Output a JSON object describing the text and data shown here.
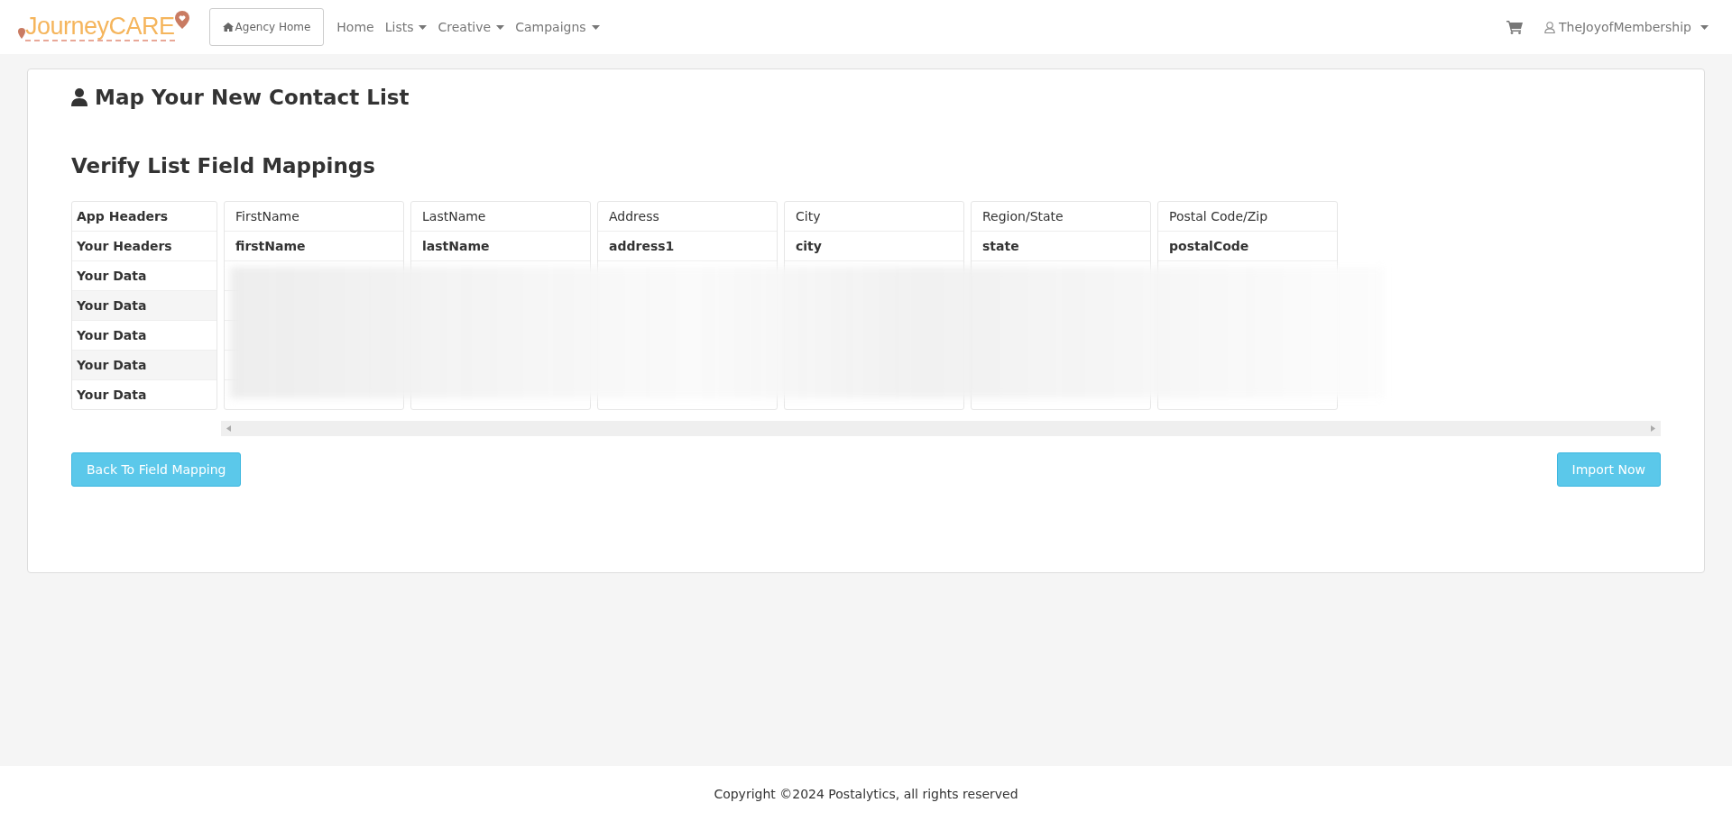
{
  "navbar": {
    "brand": "JourneyCARE",
    "agency_button": "Agency Home",
    "links": [
      {
        "label": "Home",
        "dropdown": false
      },
      {
        "label": "Lists",
        "dropdown": true
      },
      {
        "label": "Creative",
        "dropdown": true
      },
      {
        "label": "Campaigns",
        "dropdown": true
      }
    ],
    "user": {
      "label": "TheJoyofMembership",
      "dropdown": true
    }
  },
  "page": {
    "title": "Map Your New Contact List",
    "subtitle": "Verify List Field Mappings"
  },
  "mapping": {
    "row_labels": [
      "App Headers",
      "Your Headers",
      "Your Data",
      "Your Data",
      "Your Data",
      "Your Data",
      "Your Data"
    ],
    "columns": [
      {
        "app_header": "FirstName",
        "your_header": "firstName"
      },
      {
        "app_header": "LastName",
        "your_header": "lastName"
      },
      {
        "app_header": "Address",
        "your_header": "address1"
      },
      {
        "app_header": "City",
        "your_header": "city"
      },
      {
        "app_header": "Region/State",
        "your_header": "state"
      },
      {
        "app_header": "Postal Code/Zip",
        "your_header": "postalCode"
      }
    ],
    "data_blurred": true
  },
  "buttons": {
    "back": "Back To Field Mapping",
    "import": "Import Now"
  },
  "footer": "Copyright ©2024 Postalytics, all rights reserved"
}
